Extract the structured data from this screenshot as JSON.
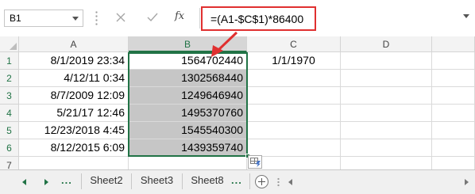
{
  "formula_bar": {
    "name_box": "B1",
    "fx_label": "fx",
    "formula": "=(A1-$C$1)*86400"
  },
  "columns": [
    "A",
    "B",
    "C",
    "D"
  ],
  "rows": [
    {
      "number": "1",
      "a": "8/1/2019 23:34",
      "b": "1564702440",
      "c": "1/1/1970"
    },
    {
      "number": "2",
      "a": "4/12/11 0:34",
      "b": "1302568440",
      "c": ""
    },
    {
      "number": "3",
      "a": "8/7/2009 12:09",
      "b": "1249646940",
      "c": ""
    },
    {
      "number": "4",
      "a": "5/21/17 12:46",
      "b": "1495370760",
      "c": ""
    },
    {
      "number": "5",
      "a": "12/23/2018 4:45",
      "b": "1545540300",
      "c": ""
    },
    {
      "number": "6",
      "a": "8/12/2015 6:09",
      "b": "1439359740",
      "c": ""
    },
    {
      "number": "7",
      "a": "",
      "b": "",
      "c": ""
    }
  ],
  "sheet_tabs": {
    "dots": "...",
    "tabs": [
      "Sheet2",
      "Sheet3",
      "Sheet8"
    ]
  },
  "colors": {
    "excel_green": "#217346",
    "callout_red": "#e03030",
    "selection_fill": "#c6c6c6"
  },
  "icons": {
    "name_box_dropdown": "chevron-down-icon",
    "cancel": "close-icon",
    "enter": "check-icon",
    "insert_function": "fx-icon",
    "add_sheet": "plus-circle-icon",
    "quick_analysis": "quick-analysis-icon",
    "callout": "arrow-icon"
  }
}
